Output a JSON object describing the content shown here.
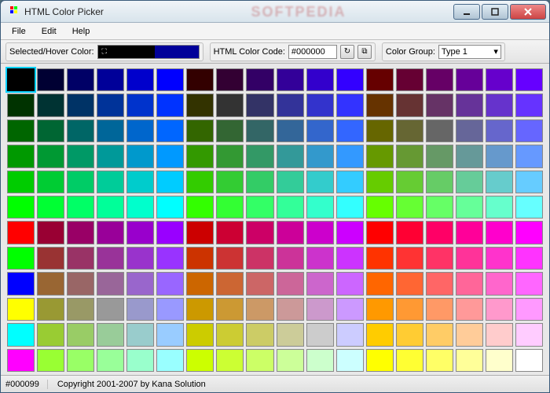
{
  "window": {
    "title": "HTML Color Picker",
    "watermark": "SOFTPEDIA"
  },
  "menu": {
    "file": "File",
    "edit": "Edit",
    "help": "Help"
  },
  "toolbar": {
    "selected_label": "Selected/Hover Color:",
    "selected_color": "#000000",
    "hover_color": "#000099",
    "code_label": "HTML Color Code:",
    "code_value": "#000000",
    "group_label": "Color Group:",
    "group_value": "Type 1"
  },
  "status": {
    "color": "#000099",
    "copyright": "Copyright 2001-2007 by Kana Solution"
  },
  "grid": {
    "selected_index": 0,
    "colors": [
      "#000000",
      "#000033",
      "#000066",
      "#000099",
      "#0000CC",
      "#0000FF",
      "#330000",
      "#330033",
      "#330066",
      "#330099",
      "#3300CC",
      "#3300FF",
      "#660000",
      "#660033",
      "#660066",
      "#660099",
      "#6600CC",
      "#6600FF",
      "#003300",
      "#003333",
      "#003366",
      "#003399",
      "#0033CC",
      "#0033FF",
      "#333300",
      "#333333",
      "#333366",
      "#333399",
      "#3333CC",
      "#3333FF",
      "#663300",
      "#663333",
      "#663366",
      "#663399",
      "#6633CC",
      "#6633FF",
      "#006600",
      "#006633",
      "#006666",
      "#006699",
      "#0066CC",
      "#0066FF",
      "#336600",
      "#336633",
      "#336666",
      "#336699",
      "#3366CC",
      "#3366FF",
      "#666600",
      "#666633",
      "#666666",
      "#666699",
      "#6666CC",
      "#6666FF",
      "#009900",
      "#009933",
      "#009966",
      "#009999",
      "#0099CC",
      "#0099FF",
      "#339900",
      "#339933",
      "#339966",
      "#339999",
      "#3399CC",
      "#3399FF",
      "#669900",
      "#669933",
      "#669966",
      "#669999",
      "#6699CC",
      "#6699FF",
      "#00CC00",
      "#00CC33",
      "#00CC66",
      "#00CC99",
      "#00CCCC",
      "#00CCFF",
      "#33CC00",
      "#33CC33",
      "#33CC66",
      "#33CC99",
      "#33CCCC",
      "#33CCFF",
      "#66CC00",
      "#66CC33",
      "#66CC66",
      "#66CC99",
      "#66CCCC",
      "#66CCFF",
      "#00FF00",
      "#00FF33",
      "#00FF66",
      "#00FF99",
      "#00FFCC",
      "#00FFFF",
      "#33FF00",
      "#33FF33",
      "#33FF66",
      "#33FF99",
      "#33FFCC",
      "#33FFFF",
      "#66FF00",
      "#66FF33",
      "#66FF66",
      "#66FF99",
      "#66FFCC",
      "#66FFFF",
      "#FF0000",
      "#990033",
      "#990066",
      "#990099",
      "#9900CC",
      "#9900FF",
      "#CC0000",
      "#CC0033",
      "#CC0066",
      "#CC0099",
      "#CC00CC",
      "#CC00FF",
      "#FF0000",
      "#FF0033",
      "#FF0066",
      "#FF0099",
      "#FF00CC",
      "#FF00FF",
      "#00FF00",
      "#993333",
      "#993366",
      "#993399",
      "#9933CC",
      "#9933FF",
      "#CC3300",
      "#CC3333",
      "#CC3366",
      "#CC3399",
      "#CC33CC",
      "#CC33FF",
      "#FF3300",
      "#FF3333",
      "#FF3366",
      "#FF3399",
      "#FF33CC",
      "#FF33FF",
      "#0000FF",
      "#996633",
      "#996666",
      "#996699",
      "#9966CC",
      "#9966FF",
      "#CC6600",
      "#CC6633",
      "#CC6666",
      "#CC6699",
      "#CC66CC",
      "#CC66FF",
      "#FF6600",
      "#FF6633",
      "#FF6666",
      "#FF6699",
      "#FF66CC",
      "#FF66FF",
      "#FFFF00",
      "#999933",
      "#999966",
      "#999999",
      "#9999CC",
      "#9999FF",
      "#CC9900",
      "#CC9933",
      "#CC9966",
      "#CC9999",
      "#CC99CC",
      "#CC99FF",
      "#FF9900",
      "#FF9933",
      "#FF9966",
      "#FF9999",
      "#FF99CC",
      "#FF99FF",
      "#00FFFF",
      "#99CC33",
      "#99CC66",
      "#99CC99",
      "#99CCCC",
      "#99CCFF",
      "#CCCC00",
      "#CCCC33",
      "#CCCC66",
      "#CCCC99",
      "#CCCCCC",
      "#CCCCFF",
      "#FFCC00",
      "#FFCC33",
      "#FFCC66",
      "#FFCC99",
      "#FFCCCC",
      "#FFCCFF",
      "#FF00FF",
      "#99FF33",
      "#99FF66",
      "#99FF99",
      "#99FFCC",
      "#99FFFF",
      "#CCFF00",
      "#CCFF33",
      "#CCFF66",
      "#CCFF99",
      "#CCFFCC",
      "#CCFFFF",
      "#FFFF00",
      "#FFFF33",
      "#FFFF66",
      "#FFFF99",
      "#FFFFCC",
      "#FFFFFF"
    ]
  }
}
